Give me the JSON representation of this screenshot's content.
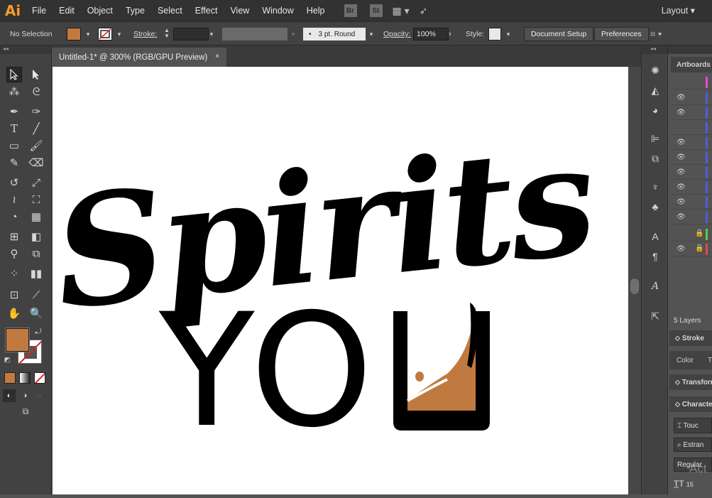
{
  "app": {
    "logo": "Ai"
  },
  "menu": [
    "File",
    "Edit",
    "Object",
    "Type",
    "Select",
    "Effect",
    "View",
    "Window",
    "Help"
  ],
  "menu_icons": {
    "bridge": "Br",
    "stock": "St"
  },
  "workspace": {
    "label": "Layout"
  },
  "control": {
    "selection": "No Selection",
    "fill_color": "#c07a40",
    "stroke_label": "Stroke:",
    "brush": "3 pt. Round",
    "opacity_label": "Opacity:",
    "opacity_value": "100%",
    "style_label": "Style:",
    "doc_setup": "Document Setup",
    "preferences": "Preferences"
  },
  "document": {
    "tab_title": "Untitled-1* @ 300% (RGB/GPU Preview)",
    "close": "×"
  },
  "artwork": {
    "line1": "Spirits",
    "line2": "YO",
    "whiskey_color": "#c07a40"
  },
  "panels": {
    "artboards": "Artboards",
    "layers_count": "5 Layers",
    "stroke": "Stroke",
    "color": "Color",
    "color_tab2": "T",
    "transform": "Transform",
    "character": "Character",
    "touch": "Touc",
    "font_name": "Estran",
    "font_style": "Regular",
    "font_size": "15",
    "watermark": "Act"
  }
}
